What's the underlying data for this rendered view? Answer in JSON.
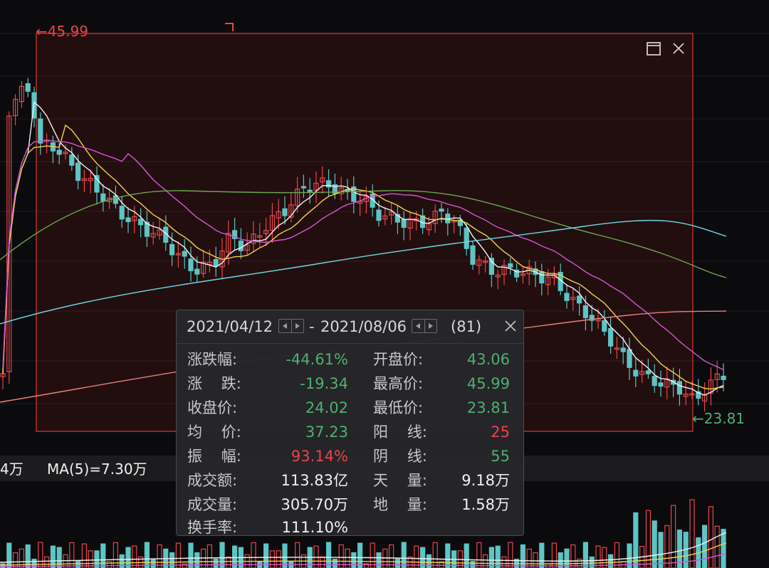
{
  "price_labels": {
    "high": "←45.99",
    "low": "←23.81"
  },
  "volume_bar": {
    "cut_text": "4万",
    "ma5": "MA(5)=7.30万"
  },
  "selection": {
    "maximize_icon": "square-icon",
    "close_icon": "close-icon"
  },
  "popup": {
    "start_date": "2021/04/12",
    "separator": "-",
    "end_date": "2021/08/06",
    "bar_count": "(81)",
    "rows_left": [
      {
        "key": "涨跌幅:",
        "value": "-44.61%",
        "color": "green"
      },
      {
        "key": "涨    跌:",
        "value": "-19.34",
        "color": "green"
      },
      {
        "key": "收盘价:",
        "value": "24.02",
        "color": "green"
      },
      {
        "key": "均    价:",
        "value": "37.23",
        "color": "green"
      },
      {
        "key": "振    幅:",
        "value": "93.14%",
        "color": "red"
      },
      {
        "key": "成交额:",
        "value": "113.83亿",
        "color": "white"
      },
      {
        "key": "成交量:",
        "value": "305.70万",
        "color": "white"
      },
      {
        "key": "换手率:",
        "value": "111.10%",
        "color": "white"
      }
    ],
    "rows_right": [
      {
        "key": "开盘价:",
        "value": "43.06",
        "color": "green"
      },
      {
        "key": "最高价:",
        "value": "45.99",
        "color": "green"
      },
      {
        "key": "最低价:",
        "value": "23.81",
        "color": "green"
      },
      {
        "key": "阳    线:",
        "value": "25",
        "color": "red"
      },
      {
        "key": "阴    线:",
        "value": "55",
        "color": "green"
      },
      {
        "key": "天    量:",
        "value": "9.18万",
        "color": "white"
      },
      {
        "key": "地    量:",
        "value": "1.58万",
        "color": "white"
      }
    ]
  },
  "colors": {
    "up": "#e8454a",
    "down": "#5ec4c4",
    "ma5": "#f2f2f2",
    "ma10": "#f0d24a",
    "ma20": "#d455d4",
    "ma30": "#6aa84f",
    "ma60": "#6fd6e6",
    "ma120": "#e8807a"
  }
}
